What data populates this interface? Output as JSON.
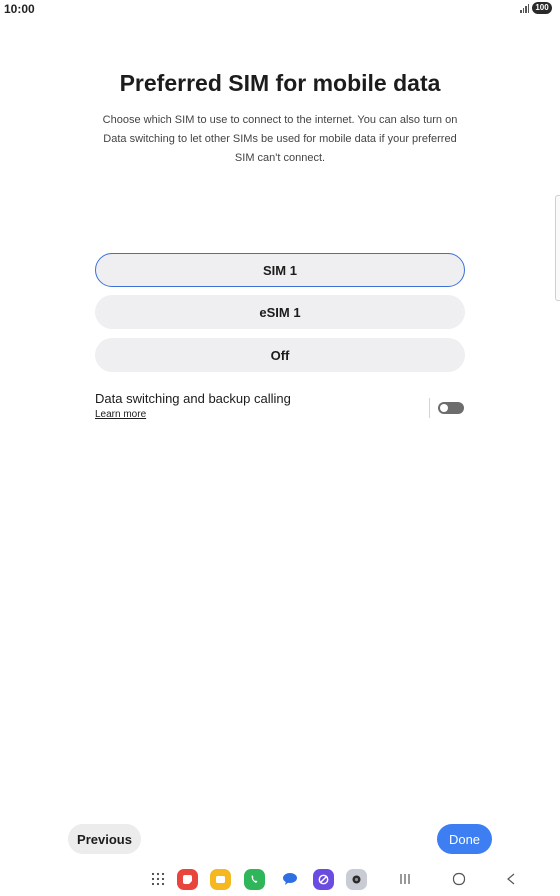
{
  "status_bar": {
    "time": "10:00",
    "battery": "100"
  },
  "page": {
    "title": "Preferred SIM for mobile data",
    "description": "Choose which SIM to use to connect to the internet. You can also turn on Data switching to let other SIMs be used for mobile data if your preferred SIM can't connect."
  },
  "sim_options": [
    {
      "label": "SIM 1",
      "selected": true
    },
    {
      "label": "eSIM 1",
      "selected": false
    },
    {
      "label": "Off",
      "selected": false
    }
  ],
  "data_switching": {
    "label": "Data switching and backup calling",
    "link": "Learn more",
    "enabled": false
  },
  "buttons": {
    "previous": "Previous",
    "done": "Done"
  },
  "colors": {
    "accent": "#3d7ef2",
    "selected_border": "#3c6fd8",
    "option_background": "#efeff1"
  },
  "nav_bar": {
    "icons": [
      "apps-grid-icon",
      "notes-app-icon",
      "my-files-app-icon",
      "phone-app-icon",
      "messages-app-icon",
      "internet-app-icon",
      "camera-app-icon",
      "recent-apps-icon",
      "home-icon",
      "back-icon"
    ]
  }
}
